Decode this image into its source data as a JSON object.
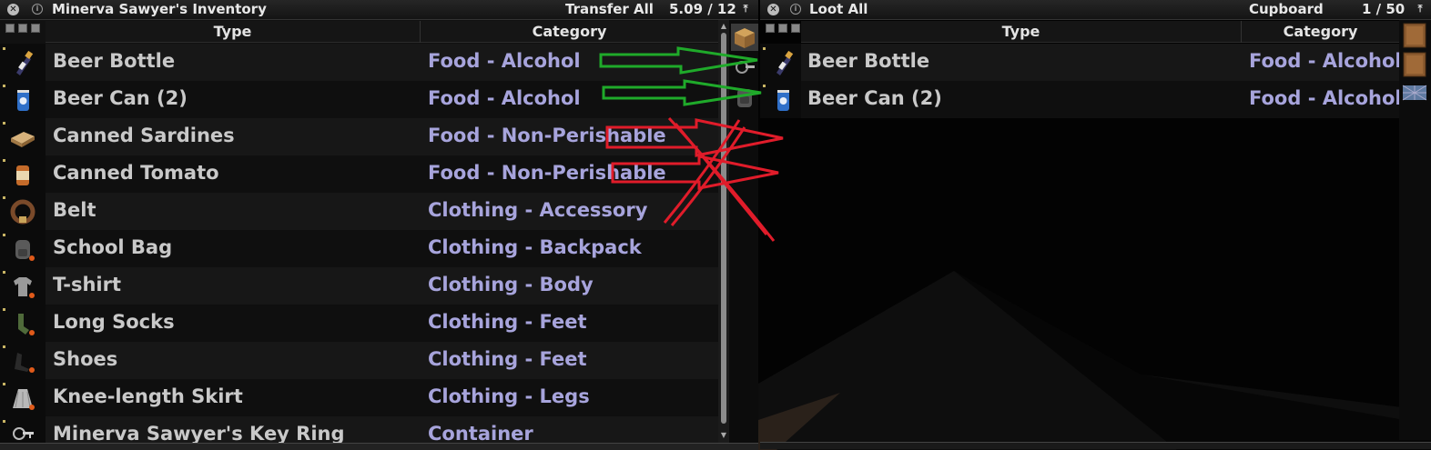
{
  "player_inventory": {
    "title": "Minerva Sawyer's Inventory",
    "action_label": "Transfer All",
    "weight": "5.09 / 12",
    "columns": {
      "type": "Type",
      "category": "Category"
    },
    "items": [
      {
        "name": "Beer Bottle",
        "category": "Food - Alcohol",
        "icon": "beer-bottle-icon"
      },
      {
        "name": "Beer Can (2)",
        "category": "Food - Alcohol",
        "icon": "beer-can-icon"
      },
      {
        "name": "Canned Sardines",
        "category": "Food - Non-Perishable",
        "icon": "canned-sardines-icon"
      },
      {
        "name": "Canned Tomato",
        "category": "Food - Non-Perishable",
        "icon": "canned-tomato-icon"
      },
      {
        "name": "Belt",
        "category": "Clothing - Accessory",
        "icon": "belt-icon"
      },
      {
        "name": "School Bag",
        "category": "Clothing - Backpack",
        "icon": "school-bag-icon"
      },
      {
        "name": "T-shirt",
        "category": "Clothing - Body",
        "icon": "tshirt-icon"
      },
      {
        "name": "Long Socks",
        "category": "Clothing - Feet",
        "icon": "socks-icon"
      },
      {
        "name": "Shoes",
        "category": "Clothing - Feet",
        "icon": "shoes-icon"
      },
      {
        "name": "Knee-length Skirt",
        "category": "Clothing - Legs",
        "icon": "skirt-icon"
      },
      {
        "name": "Minerva Sawyer's Key Ring",
        "category": "Container",
        "icon": "key-ring-icon"
      }
    ]
  },
  "container": {
    "action_label": "Loot All",
    "name": "Cupboard",
    "weight": "1 / 50",
    "columns": {
      "type": "Type",
      "category": "Category"
    },
    "items": [
      {
        "name": "Beer Bottle",
        "category": "Food - Alcohol",
        "icon": "beer-bottle-icon"
      },
      {
        "name": "Beer Can (2)",
        "category": "Food - Alcohol",
        "icon": "beer-can-icon"
      }
    ]
  },
  "colors": {
    "category_text": "#a7a4dc",
    "item_text": "#c9c9c9",
    "annotation_green": "#1faa2a",
    "annotation_red": "#e01c2a"
  }
}
